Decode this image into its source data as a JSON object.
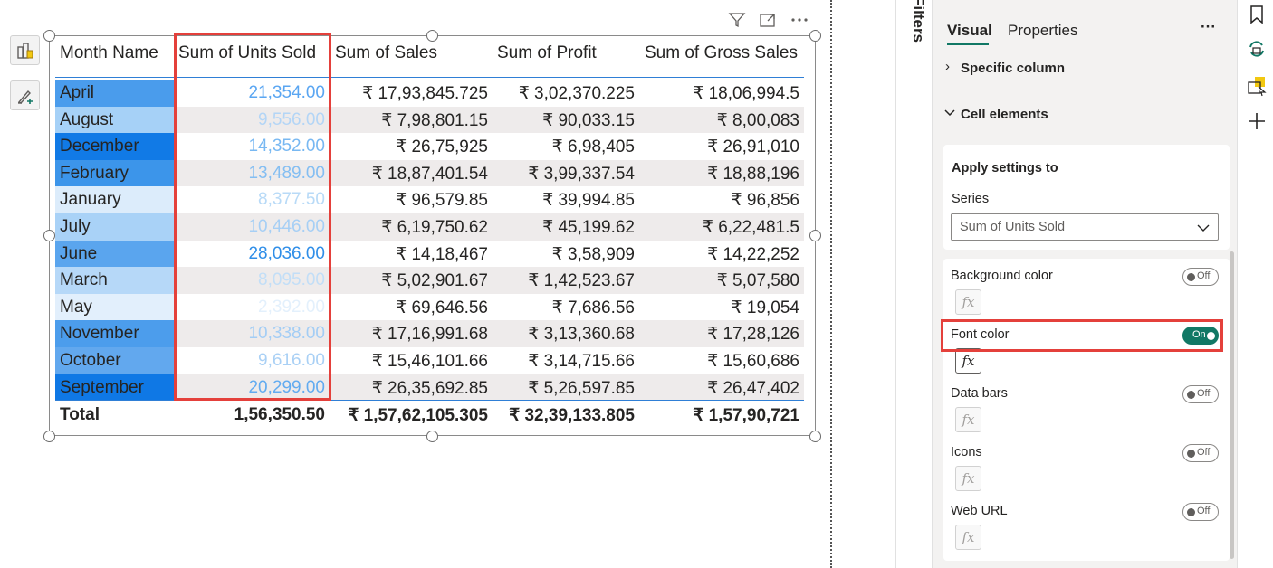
{
  "visual": {
    "columns": [
      "Month Name",
      "Sum of Units Sold",
      "Sum of Sales",
      "Sum of Profit",
      "Sum of Gross Sales"
    ],
    "rows": [
      {
        "month": "April",
        "units": "21,354.00",
        "sales": "₹ 17,93,845.725",
        "profit": "₹ 3,02,370.225",
        "gross": "₹ 18,06,994.5",
        "month_bg": "#4a9cec",
        "units_color": "#5aa6f2"
      },
      {
        "month": "August",
        "units": "9,556.00",
        "sales": "₹ 7,98,801.15",
        "profit": "₹ 90,033.15",
        "gross": "₹ 8,00,083",
        "month_bg": "#a6d1f7",
        "units_color": "#b3d5f6"
      },
      {
        "month": "December",
        "units": "14,352.00",
        "sales": "₹ 26,75,925",
        "profit": "₹ 6,98,405",
        "gross": "₹ 26,91,010",
        "month_bg": "#117ae6",
        "units_color": "#78b8f2"
      },
      {
        "month": "February",
        "units": "13,489.00",
        "sales": "₹ 18,87,401.54",
        "profit": "₹ 3,99,337.54",
        "gross": "₹ 18,88,196",
        "month_bg": "#3c95ea",
        "units_color": "#84bef2"
      },
      {
        "month": "January",
        "units": "8,377.50",
        "sales": "₹ 96,579.85",
        "profit": "₹ 39,994.85",
        "gross": "₹ 96,856",
        "month_bg": "#dcecfb",
        "units_color": "#b8daf7"
      },
      {
        "month": "July",
        "units": "10,446.00",
        "sales": "₹ 6,19,750.62",
        "profit": "₹ 45,199.62",
        "gross": "₹ 6,22,481.5",
        "month_bg": "#a9d2f7",
        "units_color": "#a6cff5"
      },
      {
        "month": "June",
        "units": "28,036.00",
        "sales": "₹ 14,18,467",
        "profit": "₹ 3,58,909",
        "gross": "₹ 14,22,252",
        "month_bg": "#5aa5ee",
        "units_color": "#2f8ee8"
      },
      {
        "month": "March",
        "units": "8,095.00",
        "sales": "₹ 5,02,901.67",
        "profit": "₹ 1,42,523.67",
        "gross": "₹ 5,07,580",
        "month_bg": "#b6d8f8",
        "units_color": "#c2def7"
      },
      {
        "month": "May",
        "units": "2,392.00",
        "sales": "₹ 69,646.56",
        "profit": "₹ 7,686.56",
        "gross": "₹ 19,054",
        "month_bg": "#e2effc",
        "units_color": "#e3f0fc"
      },
      {
        "month": "November",
        "units": "10,338.00",
        "sales": "₹ 17,16,991.68",
        "profit": "₹ 3,13,360.68",
        "gross": "₹ 17,28,126",
        "month_bg": "#4c9dec",
        "units_color": "#a3cdf5"
      },
      {
        "month": "October",
        "units": "9,616.00",
        "sales": "₹ 15,46,101.66",
        "profit": "₹ 3,14,715.66",
        "gross": "₹ 15,60,686",
        "month_bg": "#62a8ee",
        "units_color": "#a9d0f5"
      },
      {
        "month": "September",
        "units": "20,299.00",
        "sales": "₹ 26,35,692.85",
        "profit": "₹ 5,26,597.85",
        "gross": "₹ 26,47,402",
        "month_bg": "#0f78e5",
        "units_color": "#62abf0"
      }
    ],
    "total": {
      "label": "Total",
      "units": "1,56,350.50",
      "sales": "₹ 1,57,62,105.305",
      "profit": "₹ 32,39,133.805",
      "gross": "₹ 1,57,90,721"
    },
    "header_icons": [
      "filter-icon",
      "focus-mode-icon",
      "more-options-icon"
    ]
  },
  "filters": {
    "label": "Filters"
  },
  "pane": {
    "tabs": {
      "visual": "Visual",
      "properties": "Properties",
      "more": "···"
    },
    "specific_column": "Specific column",
    "cell_elements": "Cell elements",
    "apply_settings_to": "Apply settings to",
    "series_label": "Series",
    "series_value": "Sum of Units Sold",
    "options": [
      {
        "label": "Background color",
        "state": "Off"
      },
      {
        "label": "Font color",
        "state": "On"
      },
      {
        "label": "Data bars",
        "state": "Off"
      },
      {
        "label": "Icons",
        "state": "Off"
      },
      {
        "label": "Web URL",
        "state": "Off"
      }
    ],
    "fx": "fx"
  },
  "colors": {
    "accent": "#117865",
    "highlight": "#e4403b"
  }
}
